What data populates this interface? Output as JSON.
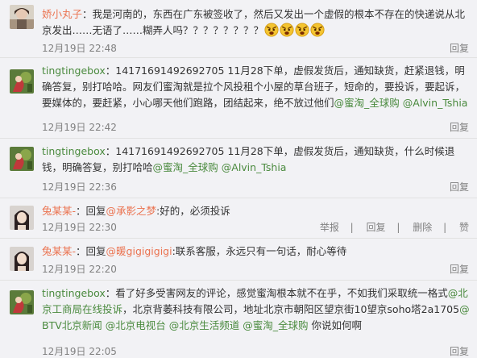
{
  "comments": [
    {
      "user": "娇小丸子",
      "text_before": "：我是河南的，东西在广东被签收了，然后又发出一个虚假的根本不存在的快递说从北京发出……无语了……糊弄人吗？？？？？？？？",
      "emoji_name": "angry-face-icon",
      "emoji_count": 4,
      "time": "12月19日 22:48",
      "actions": [
        "回复"
      ]
    },
    {
      "user": "tingtingebox",
      "text": "：14171691492692705 11月28下单，虚假发货后，通知缺货，赶紧退钱，明确答复，别打哈哈。网友们蜜淘就是拉个风投租个小屋的草台班子，短命的，要投诉，要起诉，要媒体的，要赶紧，小心哪天他们跑路，团结起来，绝不放过他们",
      "mentions": [
        "@蜜淘_全球购",
        "@Alvin_Tshia"
      ],
      "time": "12月19日 22:42",
      "actions": [
        "回复"
      ]
    },
    {
      "user": "tingtingebox",
      "text": "：14171691492692705 11月28下单，虚假发货后，通知缺货，什么时候退钱，明确答复，别打哈哈",
      "mentions": [
        "@蜜淘_全球购",
        "@Alvin_Tshia"
      ],
      "time": "12月19日 22:36",
      "actions": [
        "回复"
      ]
    },
    {
      "user": "兔某某-",
      "prefix": "：回复",
      "reply_to": "@承影之梦",
      "text": ":好的，必须投诉",
      "time": "12月19日 22:30",
      "actions": [
        "举报",
        "回复",
        "删除",
        "赞"
      ]
    },
    {
      "user": "兔某某-",
      "prefix": "：回复",
      "reply_to": "@暖gigigigigi",
      "text": ":联系客服，永远只有一句话，耐心等待",
      "time": "12月19日 22:20",
      "actions": [
        "回复"
      ]
    },
    {
      "user": "tingtingebox",
      "text_a": "：看了好多受害网友的评论，感觉蜜淘根本就不在乎，不如我们采取统一格式",
      "mention_a": "@北京工商局在线投诉",
      "text_b": "，北京背萎科技有限公司，地址北京市朝阳区望京街10望京soho塔2a1705",
      "mention_b": "@BTV北京新闻",
      "mention_c": "@北京电视台",
      "mention_d": "@北京生活频道",
      "mention_e": "@蜜淘_全球购",
      "text_c": " 你说如何啊",
      "time": "12月19日 22:05",
      "actions": [
        "回复"
      ]
    }
  ],
  "colors": {
    "username_orange": "#eb7350",
    "link_green": "#4a8a3e",
    "meta_gray": "#808080",
    "background": "#f2f2f5"
  }
}
